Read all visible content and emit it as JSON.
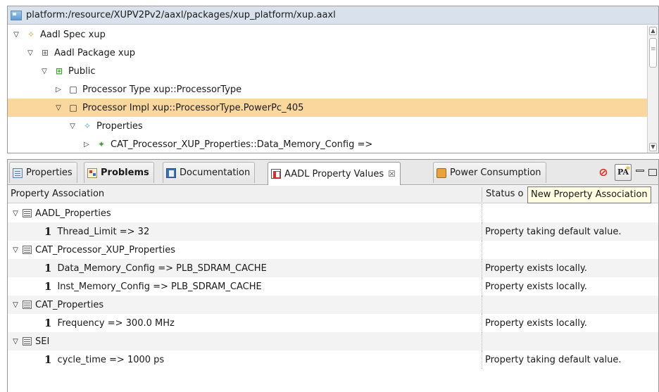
{
  "editor": {
    "title": "platform:/resource/XUPV2Pv2/aaxl/packages/xup_platform/xup.aaxl",
    "tree": [
      {
        "twisty": "▽",
        "icon": "✧",
        "label": "Aadl Spec xup"
      },
      {
        "twisty": "▽",
        "icon": "⊞",
        "label": "Aadl Package xup"
      },
      {
        "twisty": "▽",
        "icon": "⊞",
        "label": "Public"
      },
      {
        "twisty": "▷",
        "icon": "□",
        "label": "Processor Type xup::ProcessorType"
      },
      {
        "twisty": "▽",
        "icon": "□",
        "label": "Processor Impl xup::ProcessorType.PowerPc_405"
      },
      {
        "twisty": "▽",
        "icon": "✧",
        "label": "Properties"
      },
      {
        "twisty": "▷",
        "icon": "✦",
        "label": "CAT_Processor_XUP_Properties::Data_Memory_Config =>"
      }
    ]
  },
  "tabs": [
    {
      "label": "Properties"
    },
    {
      "label": "Problems"
    },
    {
      "label": "Documentation"
    },
    {
      "label": "AADL Property Values",
      "close": "☒"
    },
    {
      "label": "Power Consumption"
    }
  ],
  "toolbar": {
    "stop_icon": "⊘",
    "pa_label": "PA"
  },
  "tooltip": "New Property Association",
  "table": {
    "headers": [
      "Property Association",
      "Status o"
    ],
    "rows": [
      {
        "kind": "group",
        "label": "AADL_Properties",
        "status": ""
      },
      {
        "kind": "prop",
        "num": "1",
        "label": "Thread_Limit => 32",
        "status": "Property taking default value."
      },
      {
        "kind": "group",
        "label": "CAT_Processor_XUP_Properties",
        "status": ""
      },
      {
        "kind": "prop",
        "num": "1",
        "label": "Data_Memory_Config => PLB_SDRAM_CACHE",
        "status": "Property exists locally."
      },
      {
        "kind": "prop",
        "num": "1",
        "label": "Inst_Memory_Config => PLB_SDRAM_CACHE",
        "status": "Property exists locally."
      },
      {
        "kind": "group",
        "label": "CAT_Properties",
        "status": ""
      },
      {
        "kind": "prop",
        "num": "1",
        "label": "Frequency => 300.0 MHz",
        "status": "Property exists locally."
      },
      {
        "kind": "group",
        "label": "SEI",
        "status": ""
      },
      {
        "kind": "prop",
        "num": "1",
        "label": "cycle_time => 1000 ps",
        "status": "Property taking default value."
      }
    ]
  }
}
